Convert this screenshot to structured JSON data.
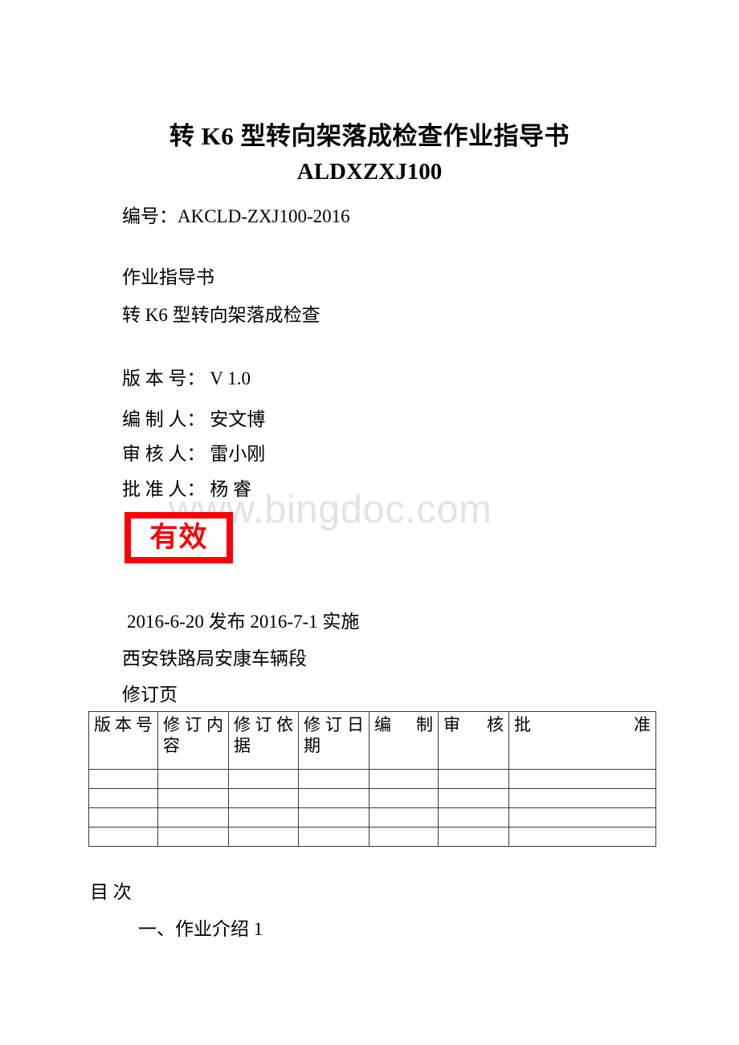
{
  "document": {
    "title_line1": "转 K6 型转向架落成检查作业指导书",
    "title_line2": "ALDXZXJ100",
    "doc_number": "编号：AKCLD-ZXJ100-2016",
    "doc_kind": "作业指导书",
    "doc_subject": "转 K6 型转向架落成检查",
    "version": "版 本 号： V 1.0",
    "writer": "编 制 人： 安文博",
    "reviewer": "审 核 人： 雷小刚",
    "approver": "批 准 人： 杨 睿",
    "dates": "2016-6-20 发布 2016-7-1 实施",
    "organization": "西安铁路局安康车辆段",
    "revision_page_label": "修订页"
  },
  "stamp": {
    "label": "有效",
    "color": "#fb0007"
  },
  "watermark": {
    "text": "www.bingdoc.com",
    "color": "#e3e3e3"
  },
  "revision_table": {
    "headers": [
      "版本号",
      "修订内容",
      "修订依据",
      "修订日期",
      "编制",
      "审核",
      "批准"
    ],
    "rows": [
      [
        "",
        "",
        "",
        "",
        "",
        "",
        ""
      ],
      [
        "",
        "",
        "",
        "",
        "",
        "",
        ""
      ],
      [
        "",
        "",
        "",
        "",
        "",
        "",
        ""
      ],
      [
        "",
        "",
        "",
        "",
        "",
        "",
        ""
      ]
    ]
  },
  "toc": {
    "title": "目 次",
    "entries": [
      {
        "text": "一、作业介绍 1"
      }
    ]
  }
}
